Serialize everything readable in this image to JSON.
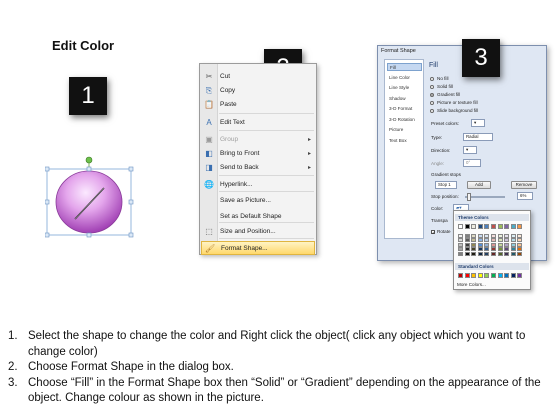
{
  "title": "Edit Color",
  "steps": [
    "1",
    "2",
    "3"
  ],
  "context_menu": {
    "items": [
      {
        "label": "Cut",
        "icon": "scissors-icon",
        "glyph": "✂",
        "color": "#555555"
      },
      {
        "label": "Copy",
        "icon": "copy-icon",
        "glyph": "⎘",
        "color": "#3a6fb0"
      },
      {
        "label": "Paste",
        "icon": "paste-icon",
        "glyph": "📋",
        "color": "#b07a2a"
      },
      {
        "label": "Edit Text",
        "icon": "edit-text-icon",
        "glyph": "A",
        "color": "#3a6fb0"
      },
      {
        "label": "Group",
        "icon": "group-icon",
        "glyph": "▣",
        "color": "#9a9a9a",
        "submenu": true,
        "disabled": true
      },
      {
        "label": "Bring to Front",
        "icon": "bring-to-front-icon",
        "glyph": "◧",
        "color": "#3a6fb0",
        "submenu": true
      },
      {
        "label": "Send to Back",
        "icon": "send-to-back-icon",
        "glyph": "◨",
        "color": "#3a6fb0",
        "submenu": true
      },
      {
        "label": "Hyperlink...",
        "icon": "hyperlink-icon",
        "glyph": "🌐",
        "color": "#2a7a3a"
      },
      {
        "label": "Save as Picture...",
        "icon": "",
        "glyph": "",
        "color": "#555555"
      },
      {
        "label": "Set as Default Shape",
        "icon": "",
        "glyph": "",
        "color": "#555555"
      },
      {
        "label": "Size and Position...",
        "icon": "size-position-icon",
        "glyph": "⬚",
        "color": "#555555"
      },
      {
        "label": "Format Shape...",
        "icon": "format-shape-icon",
        "glyph": "🖌",
        "color": "#b07a2a",
        "selected": true
      }
    ]
  },
  "dialog": {
    "title": "Format Shape",
    "categories": [
      "Fill",
      "Line Color",
      "Line Style",
      "Shadow",
      "3-D Format",
      "3-D Rotation",
      "Picture",
      "Text Box"
    ],
    "selected_category": "Fill",
    "fill_header": "Fill",
    "fill_options": [
      "No fill",
      "Solid fill",
      "Gradient fill",
      "Picture or texture fill",
      "Slide background fill"
    ],
    "selected_fill_option": "Gradient fill",
    "preset_colors_label": "Preset colors:",
    "type_label": "Type:",
    "type_value": "Radial",
    "direction_label": "Direction:",
    "angle_label": "Angle:",
    "angle_value": "0°",
    "gradient_stops_label": "Gradient stops",
    "stop_value": "Stop 1",
    "add_button": "Add",
    "remove_button": "Remove",
    "stop_position_label": "Stop position:",
    "stop_position_value": "6%",
    "color_label": "Color:",
    "transparency_label": "Transpa",
    "rotate_label": "Rotate",
    "palette": {
      "theme_header": "Theme Colors",
      "standard_header": "Standard Colors",
      "more_colors": "More Colors...",
      "theme_top_row": [
        "#ffffff",
        "#000000",
        "#eeece1",
        "#1f497d",
        "#4f81bd",
        "#c0504d",
        "#9bbb59",
        "#8064a2",
        "#4bacc6",
        "#f79646"
      ],
      "theme_columns": [
        [
          "#f2f2f2",
          "#d8d8d8",
          "#bfbfbf",
          "#a5a5a5",
          "#7f7f7f"
        ],
        [
          "#7f7f7f",
          "#595959",
          "#3f3f3f",
          "#262626",
          "#0c0c0c"
        ],
        [
          "#ddd9c3",
          "#c4bd97",
          "#938953",
          "#494429",
          "#1d1b10"
        ],
        [
          "#c6d9f0",
          "#8db3e2",
          "#548dd4",
          "#17365d",
          "#0f243e"
        ],
        [
          "#dbe5f1",
          "#b8cce4",
          "#95b3d7",
          "#366092",
          "#244061"
        ],
        [
          "#f2dcdb",
          "#e5b9b7",
          "#d99694",
          "#953734",
          "#632423"
        ],
        [
          "#ebf1dd",
          "#d7e3bc",
          "#c3d69b",
          "#76923c",
          "#4f6128"
        ],
        [
          "#e5e0ec",
          "#ccc1d9",
          "#b2a2c7",
          "#5f497a",
          "#3f3151"
        ],
        [
          "#dbeef3",
          "#b7dde8",
          "#92cddc",
          "#31859b",
          "#205867"
        ],
        [
          "#fdeada",
          "#fbd5b5",
          "#fac08f",
          "#e36c09",
          "#974806"
        ]
      ],
      "standard_row": [
        "#c00000",
        "#ff0000",
        "#ffc000",
        "#ffff00",
        "#92d050",
        "#00b050",
        "#00b0f0",
        "#0070c0",
        "#002060",
        "#7030a0"
      ]
    }
  },
  "instructions": [
    {
      "num": "1.",
      "text": "Select the shape to change the color and Right click the object( click any object which you want to change color)"
    },
    {
      "num": "2.",
      "text": "Choose Format Shape in the dialog box."
    },
    {
      "num": "3.",
      "text": "Choose “Fill” in the Format Shape box then “Solid” or “Gradient” depending on the appearance of the object. Change colour as shown in the picture."
    }
  ]
}
